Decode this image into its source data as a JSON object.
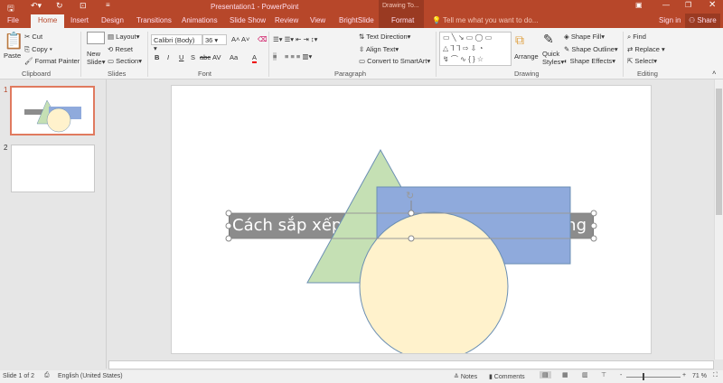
{
  "title_bar": {
    "title": "Presentation1 - PowerPoint",
    "context_label": "Drawing To...",
    "quick_access": [
      "save-icon",
      "undo-icon",
      "redo-icon",
      "slideshow-icon",
      "customize-icon"
    ],
    "window_controls": [
      "ribbon-display-icon",
      "minimize-icon",
      "restore-icon",
      "close-icon"
    ]
  },
  "tabs": [
    "File",
    "Home",
    "Insert",
    "Design",
    "Transitions",
    "Animations",
    "Slide Show",
    "Review",
    "View",
    "BrightSlide",
    "Format"
  ],
  "tell_me": "Tell me what you want to do...",
  "sign_in": "Sign in",
  "share": "Share",
  "ribbon": {
    "clipboard": {
      "label": "Clipboard",
      "paste": "Paste",
      "cut": "Cut",
      "copy": "Copy",
      "format_painter": "Format Painter"
    },
    "slides": {
      "label": "Slides",
      "new_slide": "New",
      "new_slide2": "Slide",
      "layout": "Layout",
      "reset": "Reset",
      "section": "Section"
    },
    "font": {
      "label": "Font",
      "font_name": "Calibri (Body)",
      "font_size": "36",
      "bold": "B",
      "italic": "I",
      "underline": "U",
      "shadow": "S",
      "strike": "abc",
      "spacing": "AV",
      "case": "Aa",
      "color": "A"
    },
    "paragraph": {
      "label": "Paragraph",
      "text_direction": "Text Direction",
      "align_text": "Align Text",
      "convert": "Convert to SmartArt"
    },
    "drawing": {
      "label": "Drawing",
      "arrange": "Arrange",
      "quick": "Quick",
      "styles": "Styles",
      "shape_fill": "Shape Fill",
      "shape_outline": "Shape Outline",
      "shape_effects": "Shape Effects"
    },
    "editing": {
      "label": "Editing",
      "find": "Find",
      "replace": "Replace",
      "select": "Select"
    }
  },
  "thumbnails": [
    {
      "number": "1",
      "selected": true
    },
    {
      "number": "2",
      "selected": false
    }
  ],
  "slide": {
    "text_visible_left": "Cách sắp xếp t",
    "text_visible_right": "ng"
  },
  "status": {
    "slide": "Slide 1 of 2",
    "language": "English (United States)",
    "notes": "Notes",
    "comments": "Comments",
    "zoom": "71 %"
  },
  "colors": {
    "accent": "#b7472a",
    "triangle": "#c5e0b4",
    "rectangle": "#8faadc",
    "circle": "#fff2cc",
    "textbox": "#8c8c8c"
  }
}
